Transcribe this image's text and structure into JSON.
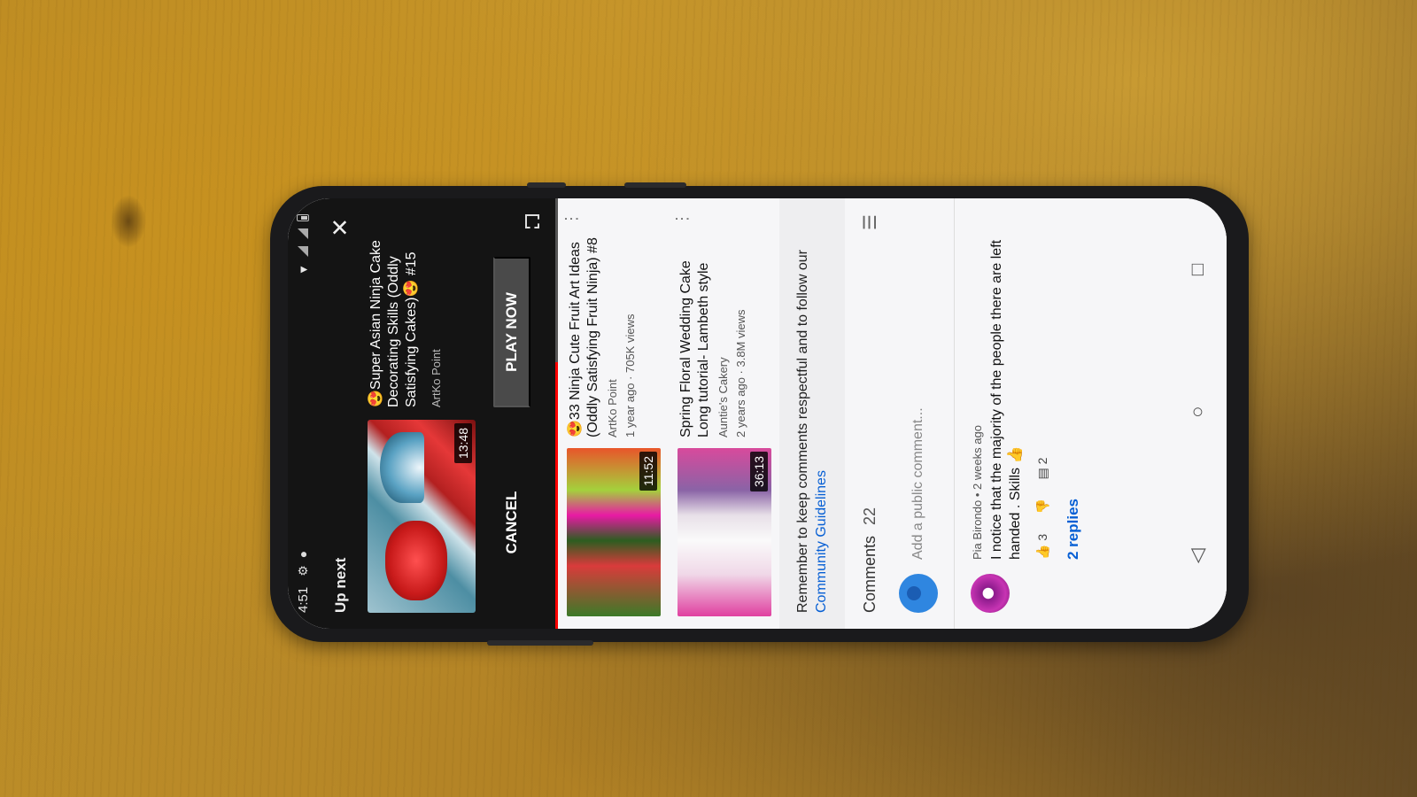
{
  "status_bar": {
    "time": "4:51"
  },
  "player": {
    "up_next_label": "Up next",
    "next_video": {
      "title": "😍Super Asian Ninja Cake Decorating Skills (Oddly Satisfying Cakes)😍 #15",
      "channel": "ArtKo Point",
      "duration": "13:48"
    },
    "cancel_label": "CANCEL",
    "play_now_label": "PLAY NOW",
    "progress": 0.62
  },
  "recommendations": [
    {
      "title": "😍33 Ninja Cute Fruit Art Ideas (Oddly Satisfying Fruit Ninja) #8",
      "channel": "ArtKo Point",
      "meta": "1 year ago · 705K views",
      "duration": "11:52"
    },
    {
      "title": "Spring Floral Wedding Cake Long tutorial- Lambeth style",
      "channel": "Auntie's Cakery",
      "meta": "2 years ago · 3.8M views",
      "duration": "36:13"
    }
  ],
  "comments": {
    "notice_text": "Remember to keep comments respectful and to follow our",
    "notice_link": "Community Guidelines",
    "heading": "Comments",
    "count": "22",
    "add_placeholder": "Add a public comment...",
    "items": [
      {
        "author_meta": "Pia Birondo • 2 weeks ago",
        "text": "I notice that the majority of the people there are left handed . Skills 👍",
        "likes": "3",
        "reply_count": "2",
        "replies_label": "2 replies"
      }
    ]
  }
}
